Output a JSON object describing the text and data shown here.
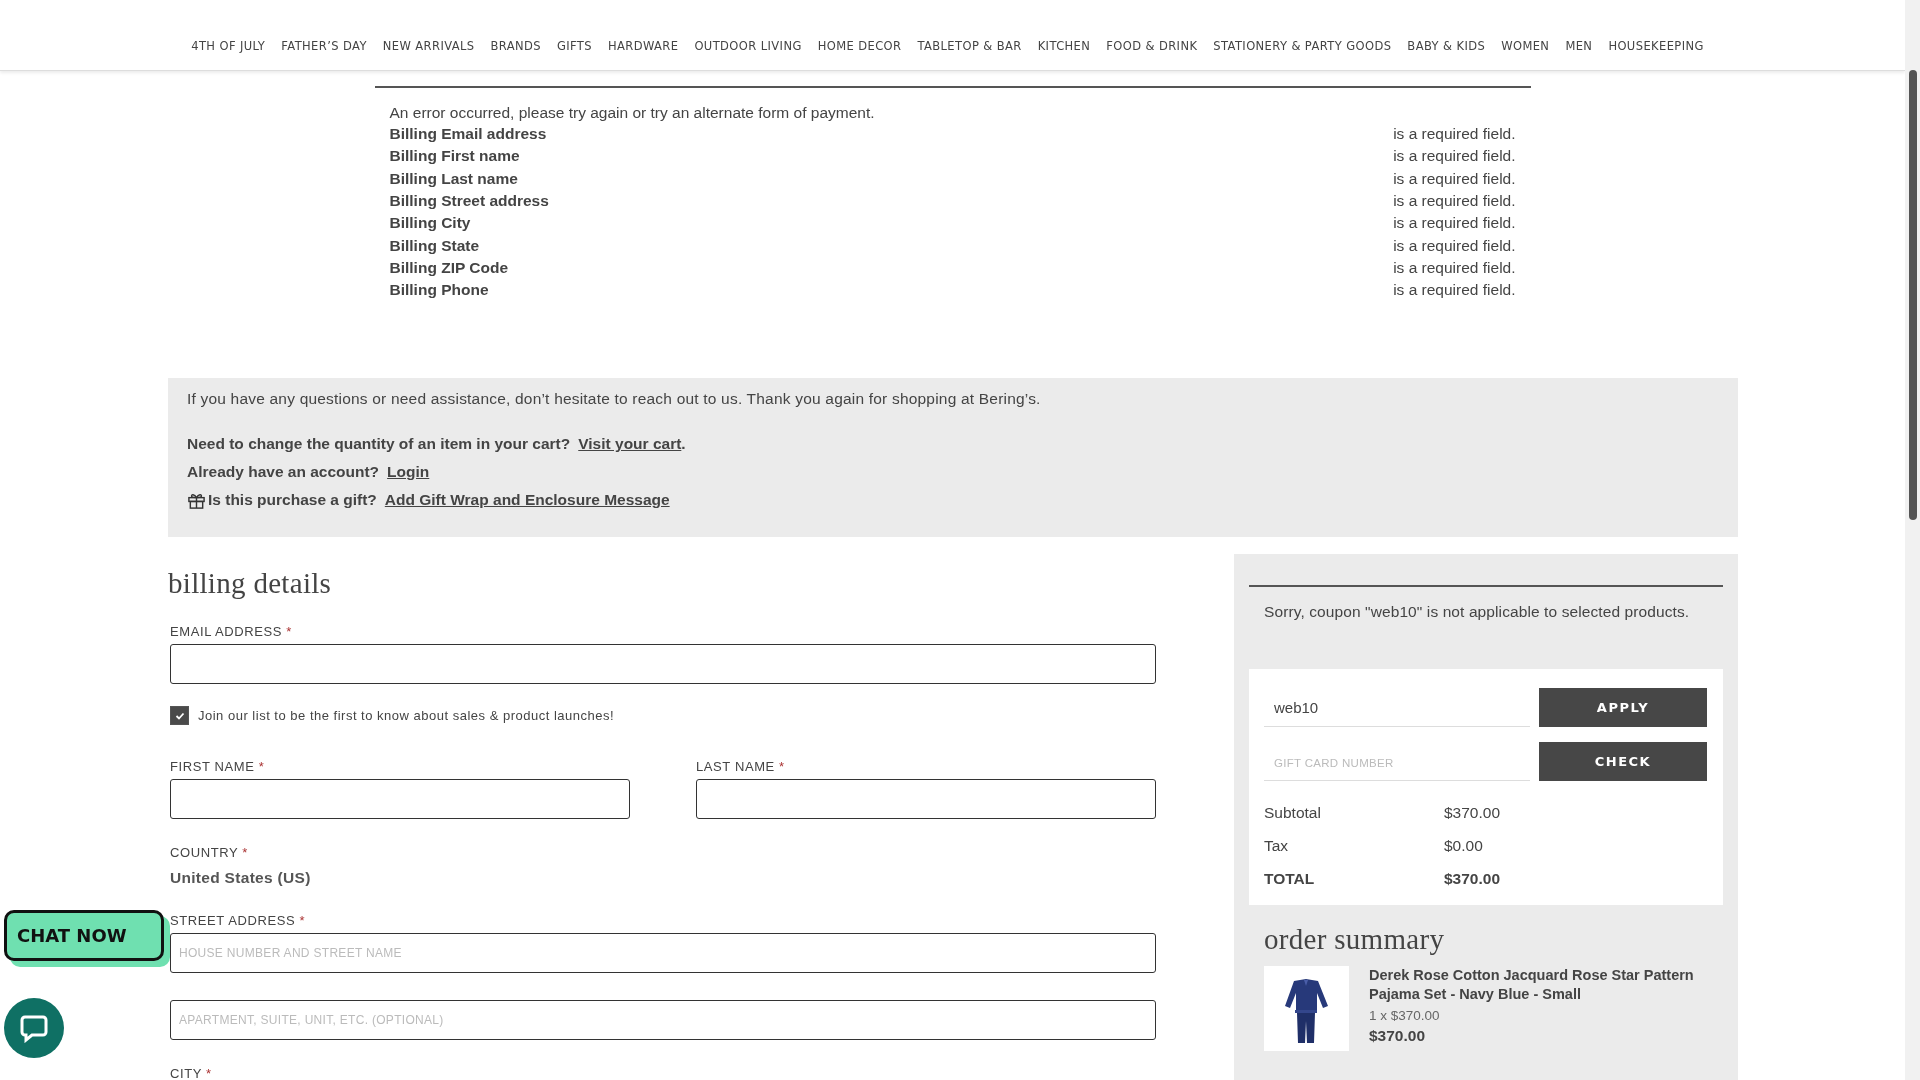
{
  "nav": {
    "items": [
      "4TH OF JULY",
      "FATHER’S DAY",
      "NEW ARRIVALS",
      "BRANDS",
      "GIFTS",
      "HARDWARE",
      "OUTDOOR LIVING",
      "HOME DECOR",
      "TABLETOP & BAR",
      "KITCHEN",
      "FOOD & DRINK",
      "STATIONERY & PARTY GOODS",
      "BABY & KIDS",
      "WOMEN",
      "MEN",
      "HOUSEKEEPING"
    ]
  },
  "errors": {
    "message": "An error occurred, please try again or try an alternate form of payment.",
    "fields": [
      {
        "field": "Billing Email address",
        "note": "is a required field."
      },
      {
        "field": "Billing First name",
        "note": "is a required field."
      },
      {
        "field": "Billing Last name",
        "note": "is a required field."
      },
      {
        "field": "Billing Street address",
        "note": "is a required field."
      },
      {
        "field": "Billing City",
        "note": "is a required field."
      },
      {
        "field": "Billing State",
        "note": "is a required field."
      },
      {
        "field": "Billing ZIP Code",
        "note": "is a required field."
      },
      {
        "field": "Billing Phone",
        "note": "is a required field."
      }
    ]
  },
  "info": {
    "message": "If you have any questions or need assistance, don’t hesitate to reach out to us. Thank you again for shopping at Bering’s.",
    "lines": [
      {
        "kind": "plain",
        "question": "Need to change the quantity of an item in your cart?",
        "link": "Visit your cart",
        "suffix": "."
      },
      {
        "kind": "plain",
        "question": "Already have an account?",
        "link": "Login"
      },
      {
        "kind": "gift",
        "question": "Is this purchase a gift?",
        "link": "Add Gift Wrap and Enclosure Message"
      }
    ]
  },
  "billing": {
    "title": "billing details",
    "rows": [
      {
        "kind": "field",
        "label": "EMAIL ADDRESS",
        "required": "*"
      },
      {
        "kind": "checkbox",
        "label": "Join our list to be the first to know about sales & product launches!",
        "checked": true
      },
      {
        "kind": "pair",
        "fields": [
          {
            "label": "FIRST NAME",
            "required": "*"
          },
          {
            "label": "LAST NAME",
            "required": "*"
          }
        ]
      },
      {
        "kind": "static",
        "label": "COUNTRY",
        "required": "*",
        "value": "United States (US)"
      },
      {
        "kind": "field",
        "label": "STREET ADDRESS",
        "required": "*",
        "placeholders": [
          "HOUSE NUMBER AND STREET NAME",
          "APARTMENT, SUITE, UNIT, ETC. (OPTIONAL)"
        ]
      },
      {
        "kind": "label",
        "label": "CITY",
        "required": "*"
      }
    ]
  },
  "order": {
    "coupon_message": "Sorry, coupon \"web10\" is not applicable to selected products.",
    "coupon": {
      "value": "web10",
      "button": "APPLY"
    },
    "gift_card": {
      "placeholder": "GIFT CARD NUMBER",
      "button": "CHECK"
    },
    "totals": [
      {
        "kind": "line",
        "label": "Subtotal",
        "value": "$370.00"
      },
      {
        "kind": "line",
        "label": "Tax",
        "value": "$0.00"
      },
      {
        "kind": "grand",
        "label": "TOTAL",
        "value": "$370.00"
      }
    ],
    "summary_title": "order summary",
    "items": [
      {
        "title": "Derek Rose Cotton Jacquard Rose Star Pattern Pajama Set - Navy Blue - Small",
        "qty": "1 x $370.00",
        "price": "$370.00"
      }
    ]
  },
  "chat": {
    "bubble": "CHAT NOW"
  }
}
